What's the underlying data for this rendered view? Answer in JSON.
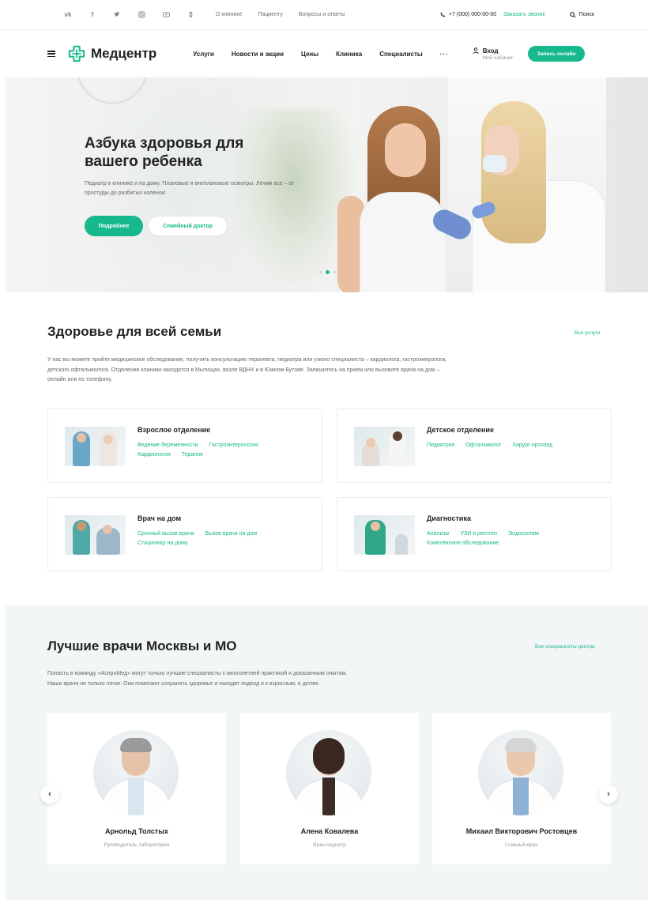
{
  "topbar": {
    "socials": [
      "vk-icon",
      "facebook-icon",
      "twitter-icon",
      "instagram-icon",
      "youtube-icon",
      "odnoklassniki-icon"
    ],
    "links": [
      "О клинике",
      "Пациенту",
      "Вопросы и ответы"
    ],
    "phone": "+7 (000) 000-00-00",
    "callback": "Заказать звонок",
    "search": "Поиск"
  },
  "header": {
    "logo": "Медцентр",
    "nav": [
      "Услуги",
      "Новости и акции",
      "Цены",
      "Клиника",
      "Специалисты",
      "···"
    ],
    "login_title": "Вход",
    "login_sub": "Мой кабинет",
    "cta": "Запись онлайн"
  },
  "hero": {
    "title": "Азбука здоровья для вашего ребенка",
    "text": "Педиатр в клинике и на дому. Плановые и внеплановые осмотры. Лечим все – от простуды до разбитых коленок!",
    "btn_primary": "Подробнее",
    "btn_secondary": "Семейный доктор",
    "slides": 3,
    "active_slide": 2
  },
  "services": {
    "title": "Здоровье для всей семьи",
    "link": "Все услуги",
    "desc": "У нас вы можете пройти медицинское обследование, получить консультацию терапевта, педиатра или узкого специалиста – кардиолога, гастроэнеролога, детского офтальмолога. Отделения клиники находятся в Мытищах, возле ВДНХ и в Южном Бутове. Запишитесь на прием или вызовите врача на дом – онлайн или по телефону.",
    "cards": [
      {
        "title": "Взрослое отделение",
        "tags": [
          "Ведение беременности",
          "Гастроэнтерология",
          "Кардиология",
          "Терапия"
        ]
      },
      {
        "title": "Детское отделение",
        "tags": [
          "Педиатрия",
          "Офтальмолог",
          "Хирург-ортопед"
        ]
      },
      {
        "title": "Врач на дом",
        "tags": [
          "Срочный вызов врача",
          "Вызов врача на дом",
          "Стационар на дому"
        ]
      },
      {
        "title": "Диагностика",
        "tags": [
          "Анализы",
          "УЗИ и рентген",
          "Эндоскопия",
          "Комплексное обследование"
        ]
      }
    ]
  },
  "doctors": {
    "title": "Лучшие врачи Москвы и МО",
    "link": "Все специалисты центра",
    "desc_1": "Попасть в команду «АспроМед» могут только лучшие специалисты с многолетней практикой и доказанным опытом.",
    "desc_2": "Наши врачи не только лечат. Они помогают сохранить здоровье и находят подход и к взрослым, и детям.",
    "list": [
      {
        "name": "Арнольд Толстых",
        "role": "Руководитель лаборатории"
      },
      {
        "name": "Алена Ковалева",
        "role": "Врач-педиатр"
      },
      {
        "name": "Михаил Викторович Ростовцев",
        "role": "Главный врач"
      }
    ],
    "prev": "‹",
    "next": "›"
  },
  "colors": {
    "accent": "#17b88b",
    "text": "#222222",
    "muted": "#666666",
    "section_bg": "#f3f6f6"
  }
}
